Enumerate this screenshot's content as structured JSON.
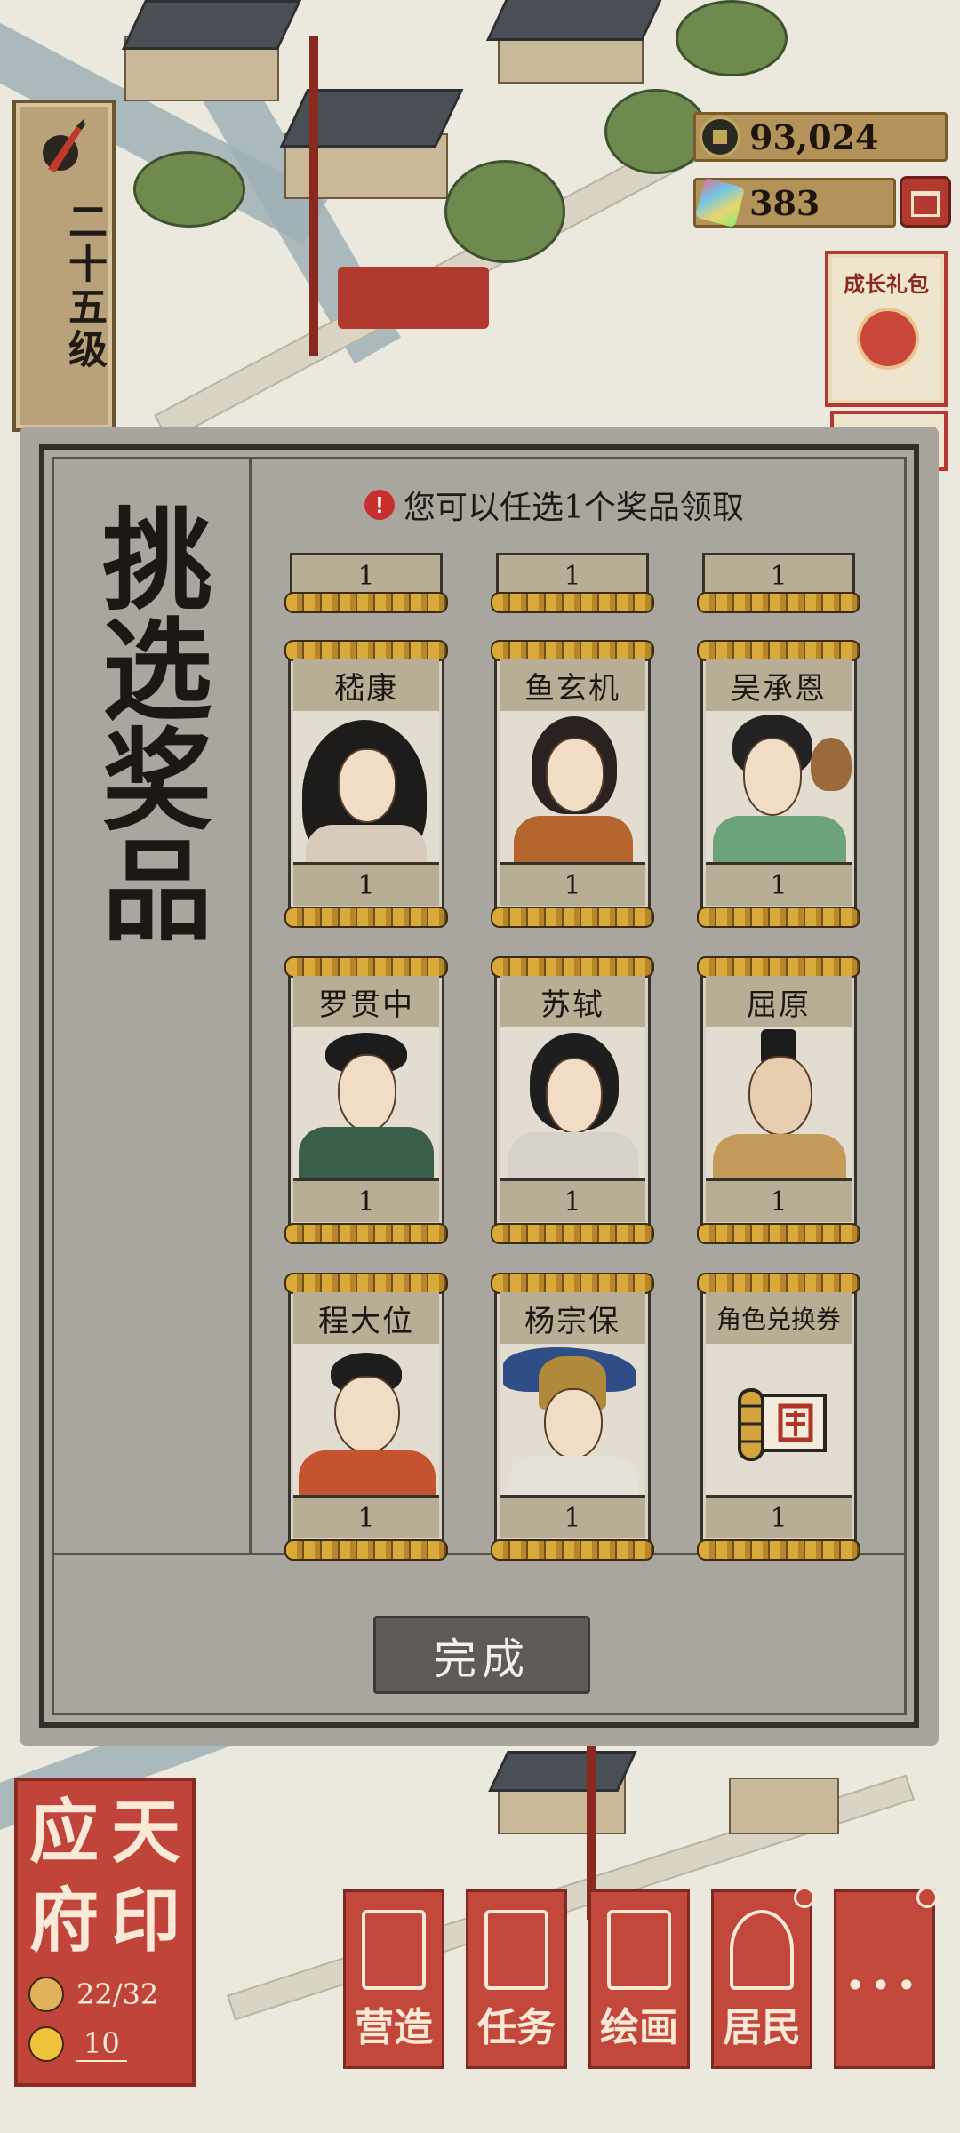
{
  "hud": {
    "level_text": "二十五级",
    "coins": "93,024",
    "gems": "383",
    "growth_pack_label": "成长礼包"
  },
  "dialog": {
    "title_chars": [
      "挑",
      "选",
      "奖",
      "品"
    ],
    "hint_icon": "!",
    "hint": "您可以任选1个奖品领取",
    "top_row_quantities": [
      "1",
      "1",
      "1"
    ],
    "rewards": [
      {
        "name": "嵇康",
        "qty": "1",
        "icon": "character-portrait"
      },
      {
        "name": "鱼玄机",
        "qty": "1",
        "icon": "character-portrait"
      },
      {
        "name": "吴承恩",
        "qty": "1",
        "icon": "character-portrait"
      },
      {
        "name": "罗贯中",
        "qty": "1",
        "icon": "character-portrait"
      },
      {
        "name": "苏轼",
        "qty": "1",
        "icon": "character-portrait"
      },
      {
        "name": "屈原",
        "qty": "1",
        "icon": "character-portrait"
      },
      {
        "name": "程大位",
        "qty": "1",
        "icon": "character-portrait"
      },
      {
        "name": "杨宗保",
        "qty": "1",
        "icon": "character-portrait"
      },
      {
        "name": "角色兑换券",
        "qty": "1",
        "icon": "scroll-voucher-icon"
      }
    ],
    "done_label": "完成"
  },
  "city": {
    "seal_chars": [
      "应",
      "天",
      "府",
      "印"
    ],
    "population": "22/32",
    "happiness": "10"
  },
  "menu": [
    {
      "label": "营造",
      "icon": "building-icon"
    },
    {
      "label": "任务",
      "icon": "task-icon"
    },
    {
      "label": "绘画",
      "icon": "painting-scroll-icon"
    },
    {
      "label": "居民",
      "icon": "resident-icon"
    },
    {
      "label": "···",
      "icon": "more-icon"
    }
  ],
  "colors": {
    "accent_red": "#c3483c",
    "dialog_bg": "#a9a6a0",
    "ribbon_gold": "#d9a93a"
  }
}
